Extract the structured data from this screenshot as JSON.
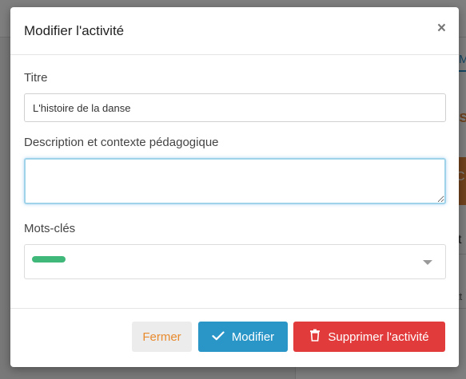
{
  "background": {
    "tab_fragment": "M",
    "orange_fragment": "IS",
    "block_fragment": "C",
    "text_fragment_1": "t",
    "text_fragment_2": "tt"
  },
  "modal": {
    "title": "Modifier l'activité",
    "close_glyph": "×",
    "fields": {
      "title_label": "Titre",
      "title_value": "L'histoire de la danse",
      "description_label": "Description et contexte pédagogique",
      "description_value": "",
      "keywords_label": "Mots-clés"
    },
    "keyword_tag_color": "#40b87a",
    "footer": {
      "close_label": "Fermer",
      "modify_label": "Modifier",
      "delete_label": "Supprimer l'activité"
    },
    "icons": {
      "modify": "check-icon",
      "delete": "trash-icon",
      "close": "close-icon",
      "select": "chevron-down-icon"
    },
    "colors": {
      "modify_button": "#2a96c8",
      "delete_button": "#e23b3b",
      "close_button_text": "#e88a2e"
    }
  }
}
